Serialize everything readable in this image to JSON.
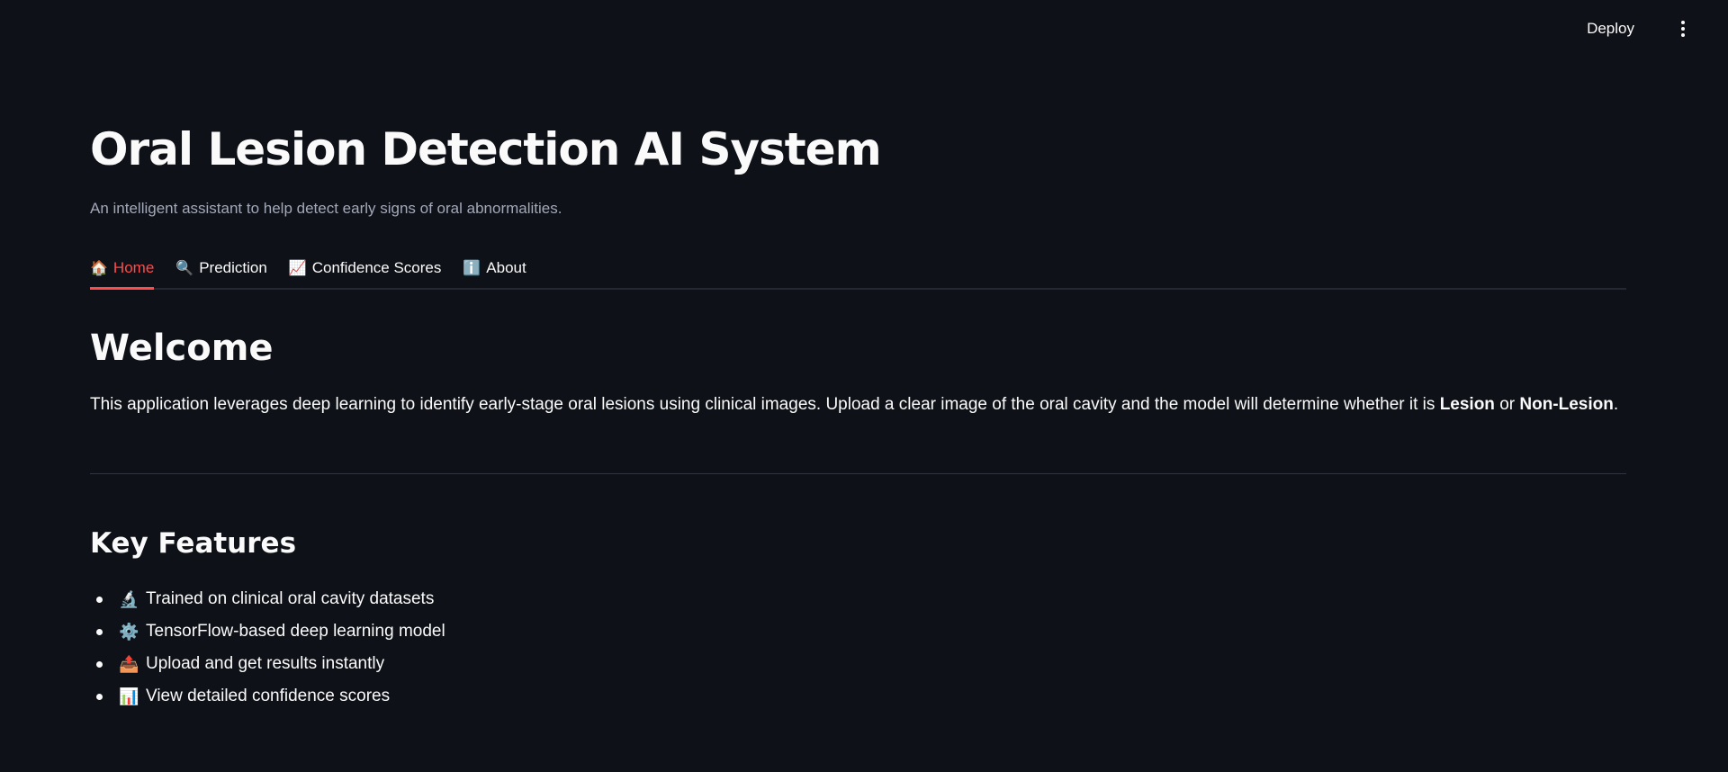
{
  "header": {
    "deploy_label": "Deploy"
  },
  "main": {
    "title": "Oral Lesion Detection AI System",
    "subtitle": "An intelligent assistant to help detect early signs of oral abnormalities.",
    "tabs": [
      {
        "icon": "🏠",
        "icon_name": "house-icon",
        "label": "Home",
        "active": true
      },
      {
        "icon": "🔍",
        "icon_name": "magnifier-icon",
        "label": "Prediction",
        "active": false
      },
      {
        "icon": "📈",
        "icon_name": "chart-icon",
        "label": "Confidence Scores",
        "active": false
      },
      {
        "icon": "ℹ️",
        "icon_name": "info-icon",
        "label": "About",
        "active": false
      }
    ],
    "welcome": {
      "heading": "Welcome",
      "text_before": "This application leverages deep learning to identify early-stage oral lesions using clinical images. Upload a clear image of the oral cavity and the model will determine whether it is ",
      "bold1": "Lesion",
      "text_mid": " or ",
      "bold2": "Non-Lesion",
      "text_after": "."
    },
    "features": {
      "heading": "Key Features",
      "items": [
        {
          "icon": "🔬",
          "icon_name": "microscope-icon",
          "label": "Trained on clinical oral cavity datasets"
        },
        {
          "icon": "⚙️",
          "icon_name": "gear-icon",
          "label": "TensorFlow-based deep learning model"
        },
        {
          "icon": "📤",
          "icon_name": "upload-icon",
          "label": "Upload and get results instantly"
        },
        {
          "icon": "📊",
          "icon_name": "bar-chart-icon",
          "label": "View detailed confidence scores"
        }
      ]
    }
  },
  "colors": {
    "background": "#0e1117",
    "accent": "#ff4b4b",
    "text": "#fafafa",
    "muted": "#a3a8b8"
  }
}
